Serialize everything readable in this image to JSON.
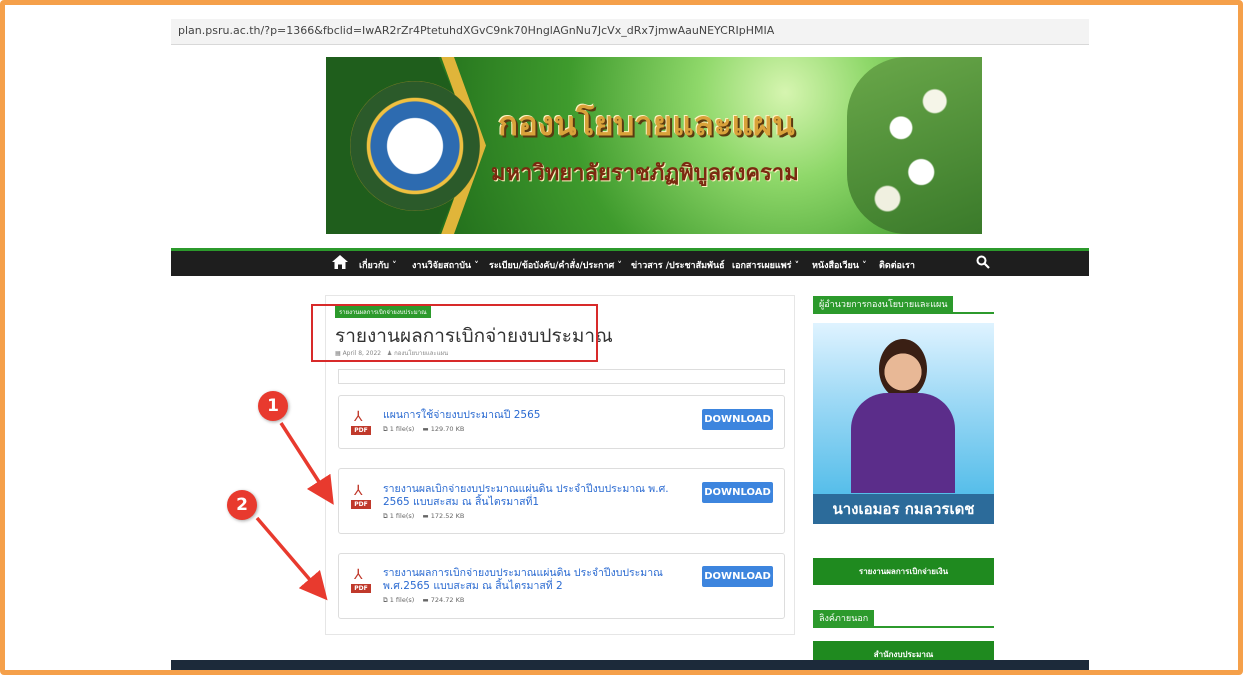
{
  "url": "plan.psru.ac.th/?p=1366&fbclid=IwAR2rZr4PtetuhdXGvC9nk70HnglAGnNu7JcVx_dRx7jmwAauNEYCRIpHMIA",
  "banner": {
    "title": "กองนโยบายและแผน",
    "subtitle": "มหาวิทยาลัยราชภัฏพิบูลสงคราม"
  },
  "nav": {
    "items": [
      "เกี่ยวกับ ˅",
      "งานวิจัยสถาบัน ˅",
      "ระเบียบ/ข้อบังคับ/คำสั่ง/ประกาศ ˅",
      "ข่าวสาร /ประชาสัมพันธ์",
      "เอกสารเผยแพร่ ˅",
      "หนังสือเวียน ˅",
      "ติดต่อเรา"
    ]
  },
  "post": {
    "category": "รายงานผลการเบิกจ่ายงบประมาณ",
    "title": "รายงานผลการเบิกจ่ายงบประมาณ",
    "date": "April 8, 2022",
    "author": "กองนโยบายและแผน"
  },
  "downloads": [
    {
      "title": "แผนการใช้จ่ายงบประมาณปี 2565",
      "files": "1 file(s)",
      "size": "129.70 KB",
      "button": "DOWNLOAD",
      "pdf_label": "PDF"
    },
    {
      "title": "รายงานผลเบิกจ่ายงบประมาณแผ่นดิน ประจำปีงบประมาณ พ.ศ. 2565 แบบสะสม ณ สิ้นไตรมาสที่1",
      "files": "1 file(s)",
      "size": "172.52 KB",
      "button": "DOWNLOAD",
      "pdf_label": "PDF"
    },
    {
      "title": "รายงานผลการเบิกจ่ายงบประมาณแผ่นดิน ประจำปีงบประมาณ พ.ศ.2565 แบบสะสม ณ สิ้นไตรมาสที่ 2",
      "files": "1 file(s)",
      "size": "724.72 KB",
      "button": "DOWNLOAD",
      "pdf_label": "PDF"
    }
  ],
  "annotations": [
    "1",
    "2"
  ],
  "sidebar": {
    "director_heading": "ผู้อำนวยการกองนโยบายและแผน",
    "director_name": "นางเอมอร กมลวรเดช",
    "report_button": "รายงานผลการเบิกจ่ายเงิน",
    "links_heading": "ลิงค์ภายนอก",
    "budget_button": "สำนักงบประมาณ"
  },
  "colors": {
    "accent": "#2c9a2c",
    "link": "#2a6ad1",
    "button": "#3d85de",
    "annotation": "#e83a2e",
    "frame": "#f5a04a"
  }
}
